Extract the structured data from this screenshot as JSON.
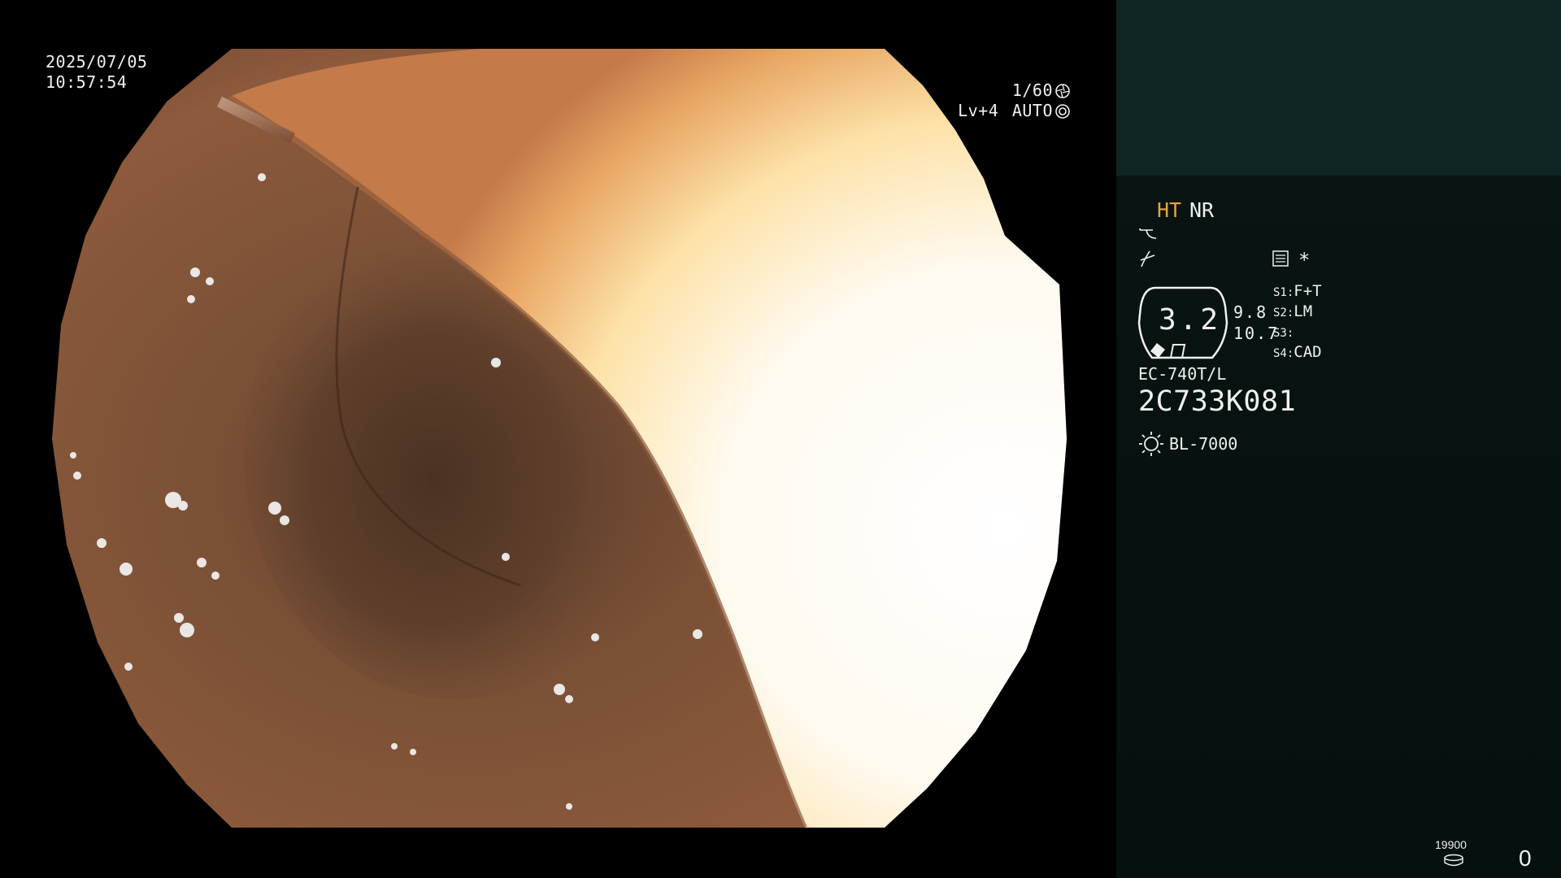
{
  "overlay": {
    "date": "2025/07/05",
    "time": "10:57:54",
    "shutter": "1/60",
    "level": "Lv+4",
    "iris_mode": "AUTO"
  },
  "panel": {
    "ht_label": "HT",
    "nr_label": "NR",
    "zoom_value": "3.2",
    "mag_top": "9.8",
    "mag_bottom": "10.7",
    "star": "*",
    "switches": [
      {
        "key": "S1:",
        "value": "F+T"
      },
      {
        "key": "S2:",
        "value": "LM"
      },
      {
        "key": "S3:",
        "value": ""
      },
      {
        "key": "S4:",
        "value": "CAD"
      }
    ],
    "scope_model": "EC-740T/L",
    "scope_serial": "2C733K081",
    "light_source": "BL-7000",
    "storage_count": "19900",
    "capture_count": "0"
  },
  "icons": {
    "shutter": "aperture-icon",
    "iris": "iris-icon",
    "light": "lamp-icon",
    "storage": "disk-icon"
  },
  "colors": {
    "ht_accent": "#e6a53c",
    "panel_bg": "#071210",
    "thumb_bg": "#0e2523"
  }
}
